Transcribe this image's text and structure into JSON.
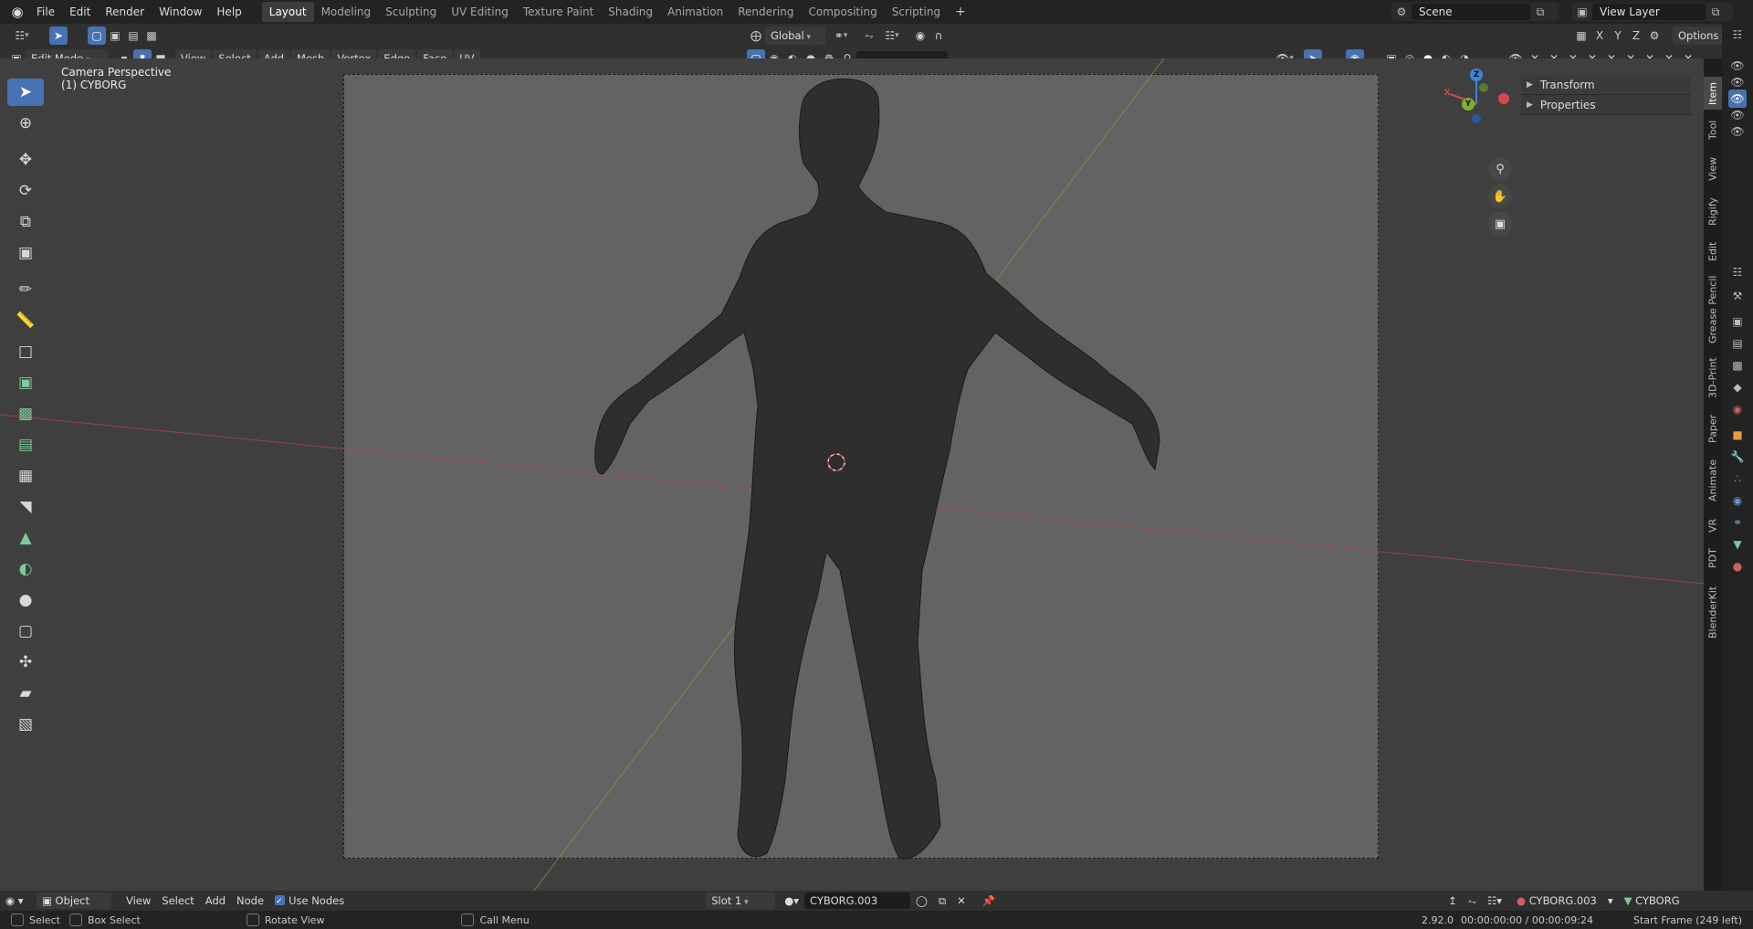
{
  "topbar": {
    "menus": [
      "File",
      "Edit",
      "Render",
      "Window",
      "Help"
    ],
    "workspaces": [
      "Layout",
      "Modeling",
      "Sculpting",
      "UV Editing",
      "Texture Paint",
      "Shading",
      "Animation",
      "Rendering",
      "Compositing",
      "Scripting"
    ],
    "active_workspace": "Layout",
    "add_workspace": "+",
    "scene": "Scene",
    "view_layer": "View Layer"
  },
  "header": {
    "mode": "Edit Mode",
    "menus": [
      "View",
      "Select",
      "Add",
      "Mesh",
      "Vertex",
      "Edge",
      "Face",
      "UV"
    ],
    "orientation": "Global",
    "options": "Options",
    "axes": [
      "X",
      "Y",
      "Z"
    ]
  },
  "viewport": {
    "camera_label": "Camera Perspective",
    "object_label": "(1) CYBORG",
    "gizmo": {
      "x": "X",
      "y": "Y",
      "z": "Z"
    }
  },
  "npanel": {
    "sections": [
      "Transform",
      "Properties"
    ],
    "tabs": [
      "Item",
      "Tool",
      "View",
      "Rigify",
      "Edit",
      "Grease Pencil",
      "3D-Print",
      "Paper",
      "Animate",
      "VR",
      "PDT",
      "BlenderKit"
    ],
    "active_tab": "Item"
  },
  "bottom": {
    "editor_type": "Object",
    "menus": [
      "View",
      "Select",
      "Add",
      "Node"
    ],
    "use_nodes_label": "Use Nodes",
    "slot": "Slot 1",
    "material": "CYBORG.003",
    "right_material": "CYBORG.003",
    "right_object": "CYBORG"
  },
  "status": {
    "select": "Select",
    "box_select": "Box Select",
    "rotate_view": "Rotate View",
    "call_menu": "Call Menu",
    "version": "2.92.0",
    "timecode": "00:00:00:00 / 00:00:09:24",
    "frame_info": "Start Frame (249 left)"
  },
  "colors": {
    "accent": "#4772b3",
    "camera_bg": "#636363",
    "viewport_bg": "#3f3f3f",
    "x_axis": "#c84a4a",
    "y_axis": "#7fb22d",
    "z_axis": "#3b83e0"
  }
}
